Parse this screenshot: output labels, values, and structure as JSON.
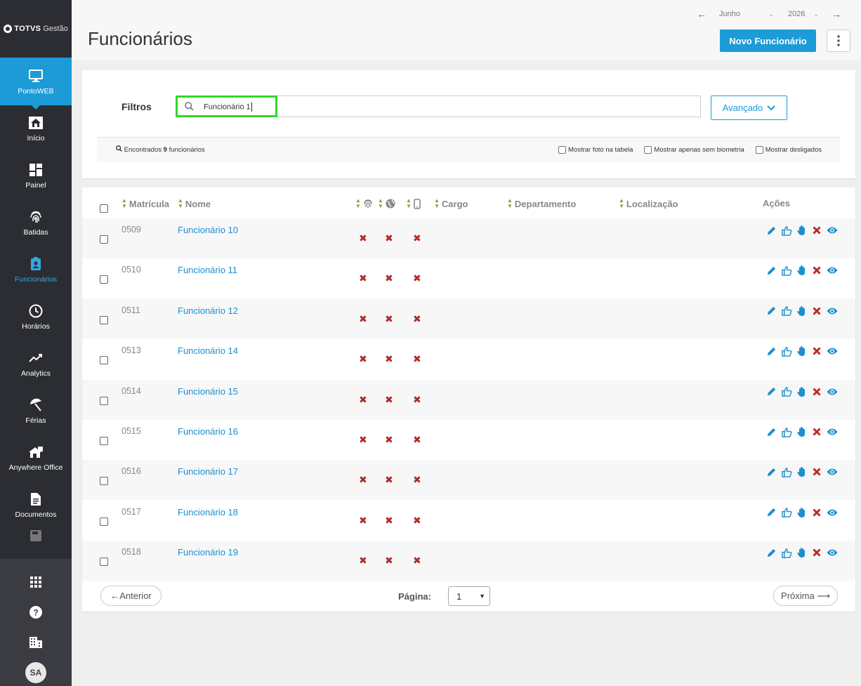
{
  "app": {
    "brand": "TOTVS",
    "brand_suffix": "Gestão"
  },
  "sidebar": {
    "items": [
      {
        "label": "PontoWEB",
        "icon": "monitor-icon"
      },
      {
        "label": "Início",
        "icon": "home-icon"
      },
      {
        "label": "Painel",
        "icon": "dashboard-icon"
      },
      {
        "label": "Batidas",
        "icon": "fingerprint-icon"
      },
      {
        "label": "Funcionários",
        "icon": "badge-icon"
      },
      {
        "label": "Horários",
        "icon": "clock-icon"
      },
      {
        "label": "Analytics",
        "icon": "trend-icon"
      },
      {
        "label": "Férias",
        "icon": "umbrella-icon"
      },
      {
        "label": "Anywhere Office",
        "icon": "home-office-icon"
      },
      {
        "label": "Documentos",
        "icon": "document-icon"
      }
    ],
    "avatar": "SA"
  },
  "header": {
    "title": "Funcionários",
    "month": "Junho",
    "year": "2026",
    "new_button": "Novo Funcionário"
  },
  "filters": {
    "label": "Filtros",
    "search_value": "Funcionário 1",
    "advanced": "Avançado",
    "found_prefix": "Encontrados",
    "found_count": "9",
    "found_suffix": "funcionários",
    "options": [
      "Mostrar foto na tabela",
      "Mostrar apenas sem biometria",
      "Mostrar desligados"
    ]
  },
  "table": {
    "columns": {
      "matricula": "Matrícula",
      "nome": "Nome",
      "cargo": "Cargo",
      "departamento": "Departamento",
      "localizacao": "Localização",
      "acoes": "Ações"
    },
    "rows": [
      {
        "matricula": "0509",
        "nome": "Funcionário 10"
      },
      {
        "matricula": "0510",
        "nome": "Funcionário 11"
      },
      {
        "matricula": "0511",
        "nome": "Funcionário 12"
      },
      {
        "matricula": "0513",
        "nome": "Funcionário 14"
      },
      {
        "matricula": "0514",
        "nome": "Funcionário 15"
      },
      {
        "matricula": "0515",
        "nome": "Funcionário 16"
      },
      {
        "matricula": "0516",
        "nome": "Funcionário 17"
      },
      {
        "matricula": "0517",
        "nome": "Funcionário 18"
      },
      {
        "matricula": "0518",
        "nome": "Funcionário 19"
      }
    ]
  },
  "pagination": {
    "prev": "←Anterior",
    "page_label": "Página:",
    "page_value": "1",
    "next": "Próxima ⟶"
  },
  "colors": {
    "accent": "#1c9bd7",
    "sidebar": "#2b2d33",
    "danger": "#b12a2a",
    "highlight": "#36d62b"
  }
}
